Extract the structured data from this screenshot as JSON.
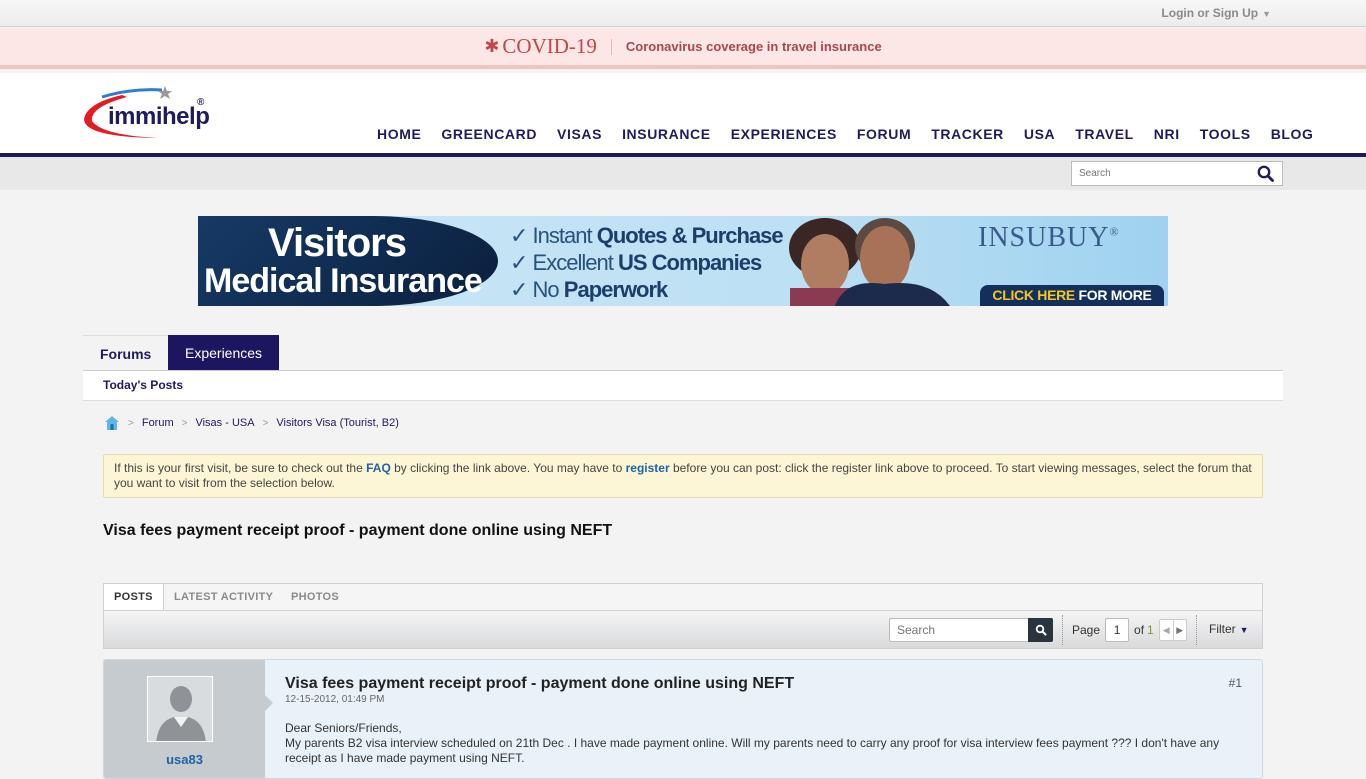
{
  "topbar": {
    "login_label": "Login or Sign Up",
    "caret": "▼"
  },
  "covid": {
    "logo_text": "COVID-19",
    "star": "✱",
    "link_text": "Coronavirus coverage in travel insurance"
  },
  "header": {
    "logo_text": "immihelp",
    "logo_reg": "®",
    "nav": [
      {
        "label": "HOME"
      },
      {
        "label": "GREENCARD"
      },
      {
        "label": "VISAS"
      },
      {
        "label": "INSURANCE"
      },
      {
        "label": "EXPERIENCES"
      },
      {
        "label": "FORUM",
        "active": true
      },
      {
        "label": "TRACKER"
      },
      {
        "label": "USA"
      },
      {
        "label": "TRAVEL"
      },
      {
        "label": "NRI"
      },
      {
        "label": "TOOLS"
      },
      {
        "label": "BLOG"
      }
    ],
    "search_placeholder": "Search"
  },
  "ad": {
    "title1": "Visitors",
    "title2": "Medical Insurance",
    "bullets": [
      {
        "light": "Instant ",
        "bold": "Quotes & Purchase"
      },
      {
        "light": "Excellent ",
        "bold": "US Companies"
      },
      {
        "light": "No ",
        "bold": "Paperwork"
      }
    ],
    "brand": "INSUBUY",
    "brand_reg": "®",
    "cta_highlight": "CLICK HERE",
    "cta_rest": "FOR MORE"
  },
  "forum_tabs": [
    {
      "label": "Forums"
    },
    {
      "label": "Experiences"
    }
  ],
  "subnav": {
    "todays_posts": "Today's Posts"
  },
  "breadcrumb": [
    {
      "label": "Forum"
    },
    {
      "label": "Visas - USA"
    },
    {
      "label": "Visitors Visa (Tourist, B2)"
    }
  ],
  "notice": {
    "part1": "If this is your first visit, be sure to check out the ",
    "faq": "FAQ",
    "part2": " by clicking the link above. You may have to ",
    "register": "register",
    "part3": " before you can post: click the register link above to proceed. To start viewing messages, select the forum that you want to visit from the selection below."
  },
  "thread": {
    "title": "Visa fees payment receipt proof - payment done online using NEFT"
  },
  "post_tabs": [
    {
      "label": "POSTS"
    },
    {
      "label": "LATEST ACTIVITY"
    },
    {
      "label": "PHOTOS"
    }
  ],
  "toolbar": {
    "search_placeholder": "Search",
    "page_label": "Page",
    "page_current": "1",
    "of_label": "of",
    "page_total": "1",
    "filter_label": "Filter"
  },
  "post": {
    "username": "usa83",
    "title": "Visa fees payment receipt proof - payment done online using NEFT",
    "date": "12-15-2012, 01:49 PM",
    "number": "#1",
    "greeting": "Dear Seniors/Friends,",
    "body": "My parents B2 visa interview scheduled on 21th Dec . I have made payment online. Will my parents need to carry any proof for visa interview fees payment ??? I don't have any receipt as I have made payment using NEFT."
  }
}
